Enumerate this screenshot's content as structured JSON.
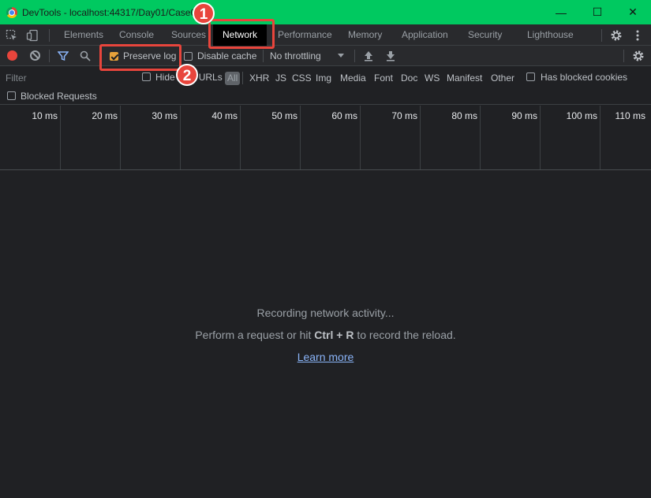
{
  "window": {
    "title": "DevTools - localhost:44317/Day01/Case0",
    "controls": {
      "minimize": "—",
      "maximize": "☐",
      "close": "✕"
    }
  },
  "tabs": [
    {
      "label": "Elements"
    },
    {
      "label": "Console"
    },
    {
      "label": "Sources"
    },
    {
      "label": "Network",
      "active": true
    },
    {
      "label": "Performance"
    },
    {
      "label": "Memory"
    },
    {
      "label": "Application"
    },
    {
      "label": "Security"
    },
    {
      "label": "Lighthouse"
    }
  ],
  "toolbar": {
    "preserve_log": {
      "label": "Preserve log",
      "checked": true
    },
    "disable_cache": {
      "label": "Disable cache",
      "checked": false
    },
    "throttling": "No throttling"
  },
  "filter": {
    "placeholder": "Filter",
    "hide_data_urls": "Hide data URLs",
    "types": [
      "All",
      "XHR",
      "JS",
      "CSS",
      "Img",
      "Media",
      "Font",
      "Doc",
      "WS",
      "Manifest",
      "Other"
    ],
    "selected_type": "All",
    "has_blocked_cookies": "Has blocked cookies",
    "blocked_requests": "Blocked Requests"
  },
  "timeline": {
    "ticks": [
      "10 ms",
      "20 ms",
      "30 ms",
      "40 ms",
      "50 ms",
      "60 ms",
      "70 ms",
      "80 ms",
      "90 ms",
      "100 ms",
      "110 ms"
    ]
  },
  "empty_state": {
    "line1": "Recording network activity...",
    "line2_prefix": "Perform a request or hit ",
    "line2_keys": "Ctrl + R",
    "line2_suffix": " to record the reload.",
    "link": "Learn more"
  },
  "annotations": [
    {
      "number": "1",
      "target": "Network"
    },
    {
      "number": "2",
      "target": "Preserve log"
    }
  ],
  "colors": {
    "titlebar": "#00c960",
    "panel_bg": "#202124",
    "accent_red": "#e8453c",
    "checkbox_checked": "#e8a23a",
    "link": "#8ab4f8"
  }
}
